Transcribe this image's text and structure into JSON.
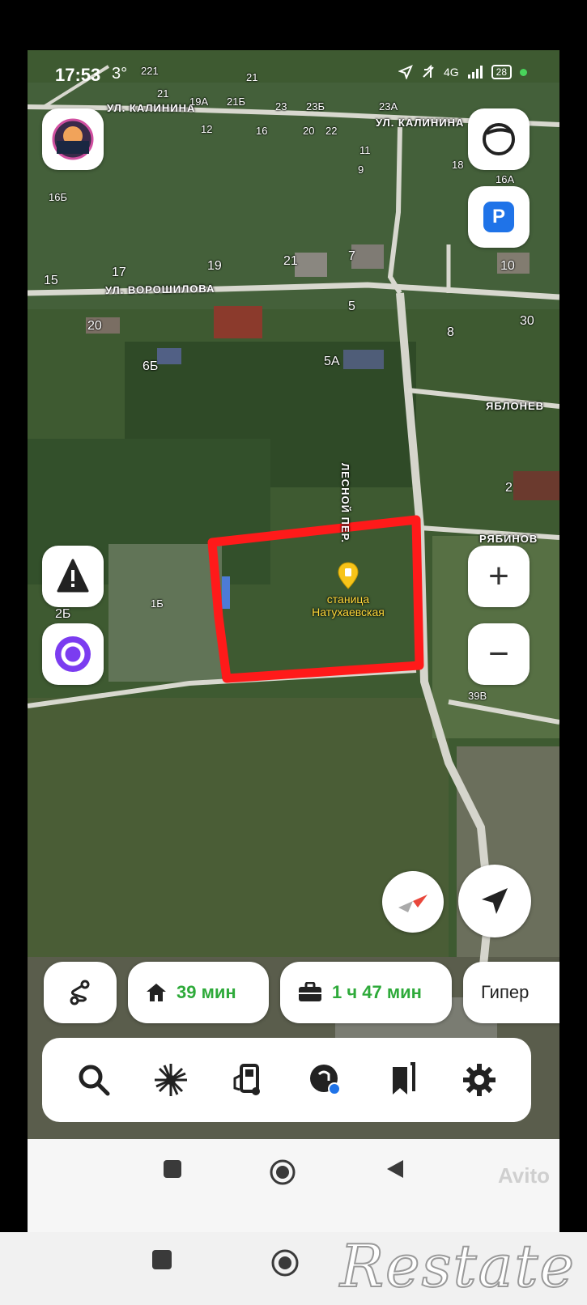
{
  "status_bar": {
    "time": "17:53",
    "extra": "3°",
    "network": "4G",
    "battery": "28"
  },
  "map": {
    "streets": {
      "kalinina_left": "УЛ. КАЛИНИНА",
      "kalinina_right": "УЛ. КАЛИНИНА",
      "voroshilova": "УЛ. ВОРОШИЛОВА",
      "lesnoy": "ЛЕСНОЙ ПЕР.",
      "yablonevaya": "ЯБЛОНЕВ",
      "ryabinovaya": "РЯБИНОВ"
    },
    "houses": {
      "h221": "221",
      "h21a": "21",
      "h21b": "21",
      "h19a": "19А",
      "h21b2": "21Б",
      "h23": "23",
      "h23b": "23Б",
      "h12": "12",
      "h16": "16",
      "h20": "20",
      "h22": "22",
      "h23a": "23А",
      "h11": "11",
      "h18": "18",
      "h9": "9",
      "h16a": "16А",
      "h16b": "16Б",
      "h15": "15",
      "h17": "17",
      "h19": "19",
      "h21c": "21",
      "h7": "7",
      "h10": "10",
      "h5": "5",
      "h20b": "20",
      "h30": "30",
      "h8": "8",
      "h6b": "6Б",
      "h5a": "5А",
      "h2": "2",
      "h2b": "2Б",
      "h1b": "1Б",
      "h39v": "39В"
    },
    "marker_label_line1": "станица",
    "marker_label_line2": "Натухаевская",
    "plot_outline_color": "#ff1a1a"
  },
  "buttons": {
    "avatar": "profile-avatar",
    "layers": "layers-icon",
    "parking": "P",
    "zoom_in": "+",
    "zoom_out": "−",
    "alert": "alert-icon",
    "alice": "alice-icon",
    "compass": "compass-icon",
    "locate": "locate-arrow-icon"
  },
  "routes": {
    "home_time": "39 мин",
    "work_time": "1 ч 47 мин",
    "third_label": "Гипер"
  },
  "toolbar": {
    "items": [
      "search-icon",
      "sparkle-icon",
      "fuel-icon",
      "discovery-icon",
      "bookmarks-icon",
      "settings-icon"
    ]
  },
  "watermarks": {
    "avito": "Avito",
    "restate": "Restate"
  },
  "colors": {
    "accent_blue": "#1f73e8",
    "alice_purple": "#7b3cf0",
    "route_green": "#2eaa3a",
    "marker_yellow": "#f7c419"
  }
}
